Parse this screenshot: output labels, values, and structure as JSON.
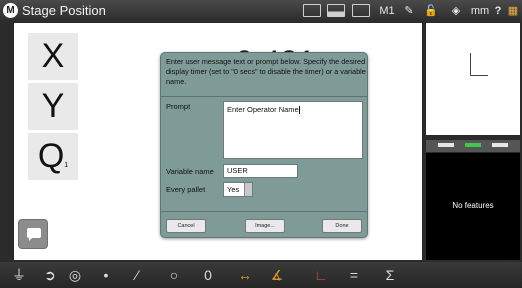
{
  "window": {
    "title": "Stage Position",
    "units": "mm",
    "m1_label": "M1",
    "help_label": "?"
  },
  "axes": [
    {
      "key": "X",
      "sub": ""
    },
    {
      "key": "Y",
      "sub": ""
    },
    {
      "key": "Q",
      "sub": "1"
    }
  ],
  "readout": {
    "value": "0.431"
  },
  "features_panel": {
    "empty_text": "No features"
  },
  "dialog": {
    "description": "Enter user message text or prompt below. Specify the desired display timer (set to \"0 secs\" to disable the timer) or a variable name.",
    "prompt_label": "Prompt",
    "prompt_value": "Enter Operator Name",
    "variable_label": "Variable name",
    "variable_value": "USER",
    "every_pallet_label": "Every pallet",
    "every_pallet_value": "Yes",
    "buttons": {
      "cancel": "Cancel",
      "image": "Image...",
      "done": "Done"
    }
  },
  "bottom_toolbar": [
    {
      "name": "probe-tool-icon",
      "glyph": "⏚"
    },
    {
      "name": "target-arrow-icon",
      "glyph": "➲"
    },
    {
      "name": "circle-dot-icon",
      "glyph": "◎"
    },
    {
      "name": "point-icon",
      "glyph": "•"
    },
    {
      "name": "line-icon",
      "glyph": "⁄"
    },
    {
      "name": "circle-icon",
      "glyph": "○"
    },
    {
      "name": "slot-icon",
      "glyph": "0"
    },
    {
      "name": "distance-icon",
      "glyph": "↔"
    },
    {
      "name": "angle-icon",
      "glyph": "∡"
    },
    {
      "name": "coordinate-system-icon",
      "glyph": "∟"
    },
    {
      "name": "equals-icon",
      "glyph": "="
    },
    {
      "name": "sigma-icon",
      "glyph": "Σ"
    }
  ],
  "colors": {
    "dialog_bg": "#7f9b98",
    "active_tab": "#3cc84a"
  }
}
